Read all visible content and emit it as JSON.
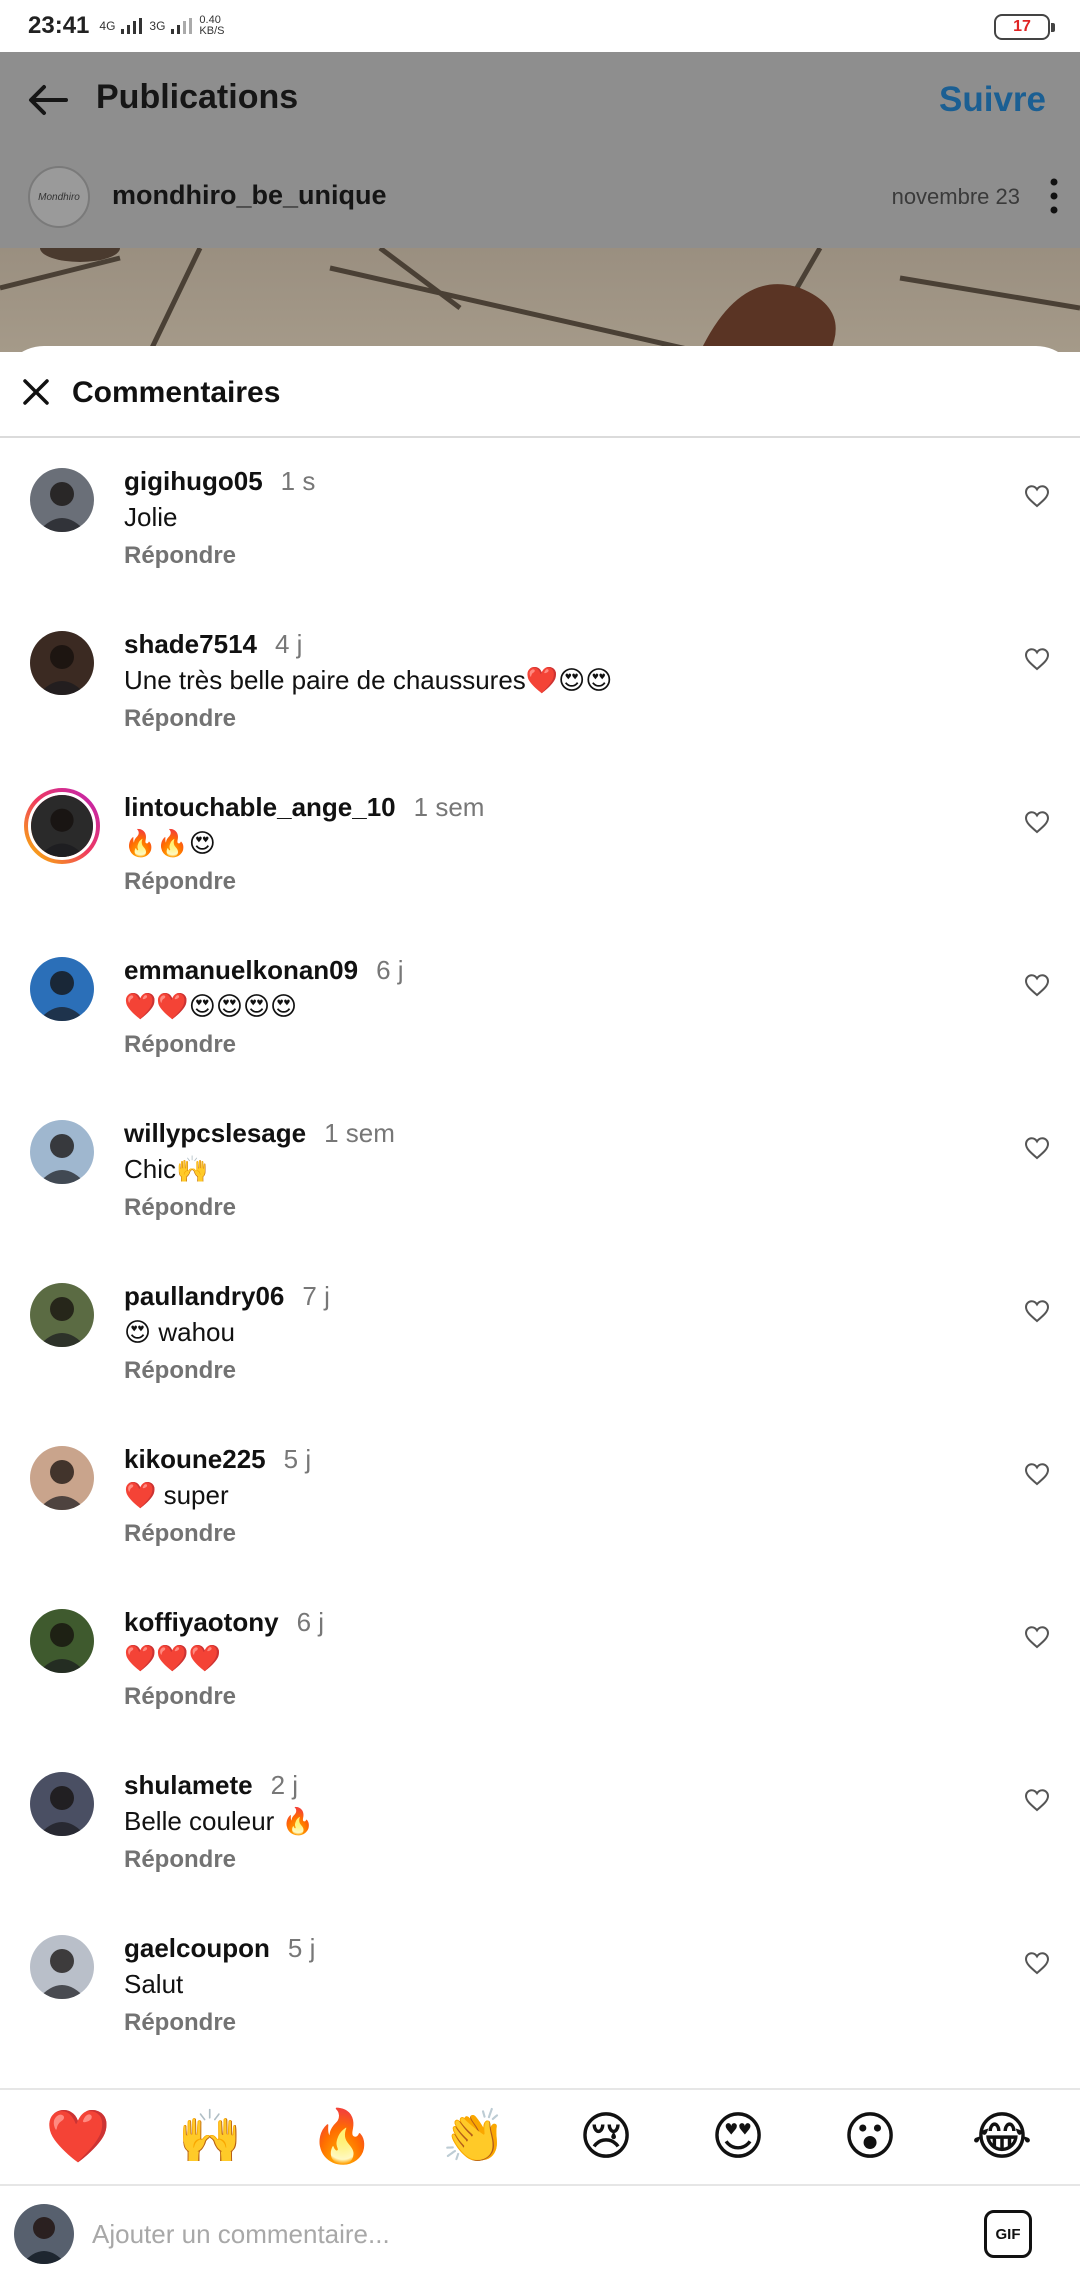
{
  "status_bar": {
    "time": "23:41",
    "network_1": "4G",
    "network_2": "3G",
    "speed_value": "0.40",
    "speed_unit": "KB/S",
    "battery": "17"
  },
  "header": {
    "title": "Publications",
    "follow_label": "Suivre"
  },
  "post": {
    "author": "mondhiro_be_unique",
    "author_logo_text": "Mondhiro",
    "date": "novembre 23"
  },
  "comments_sheet": {
    "title": "Commentaires",
    "reply_label": "Répondre",
    "comments": [
      {
        "user": "gigihugo05",
        "time": "1 s",
        "text": "Jolie",
        "avatar_color": "#6a6f78"
      },
      {
        "user": "shade7514",
        "time": "4 j",
        "text": "Une très belle paire de chaussures❤️😍😍",
        "avatar_color": "#3b2a22"
      },
      {
        "user": "lintouchable_ange_10",
        "time": "1 sem",
        "text": "🔥🔥😍",
        "avatar_color": "#2a2a2a"
      },
      {
        "user": "emmanuelkonan09",
        "time": "6 j",
        "text": "❤️❤️😍😍😍😍",
        "avatar_color": "#2b6fb8"
      },
      {
        "user": "willypcslesage",
        "time": "1 sem",
        "text": "Chic🙌",
        "avatar_color": "#9fb7cf"
      },
      {
        "user": "paullandry06",
        "time": "7 j",
        "text": "😍 wahou",
        "avatar_color": "#5b6b43"
      },
      {
        "user": "kikoune225",
        "time": "5 j",
        "text": "❤️ super",
        "avatar_color": "#c9a48c"
      },
      {
        "user": "koffiyaotony",
        "time": "6 j",
        "text": "❤️❤️❤️",
        "avatar_color": "#3f5a2e"
      },
      {
        "user": "shulamete",
        "time": "2 j",
        "text": "Belle couleur 🔥",
        "avatar_color": "#4a4f63"
      },
      {
        "user": "gaelcoupon",
        "time": "5 j",
        "text": "Salut",
        "avatar_color": "#b9bfc9"
      }
    ]
  },
  "quick_emojis": [
    "❤️",
    "🙌",
    "🔥",
    "👏",
    "😢",
    "😍",
    "😮",
    "😂"
  ],
  "composer": {
    "placeholder": "Ajouter un commentaire...",
    "gif_label": "GIF",
    "avatar_color": "#57606e"
  },
  "colors": {
    "accent": "#1b5f93",
    "battery_low": "#e02424",
    "muted": "#737373"
  }
}
